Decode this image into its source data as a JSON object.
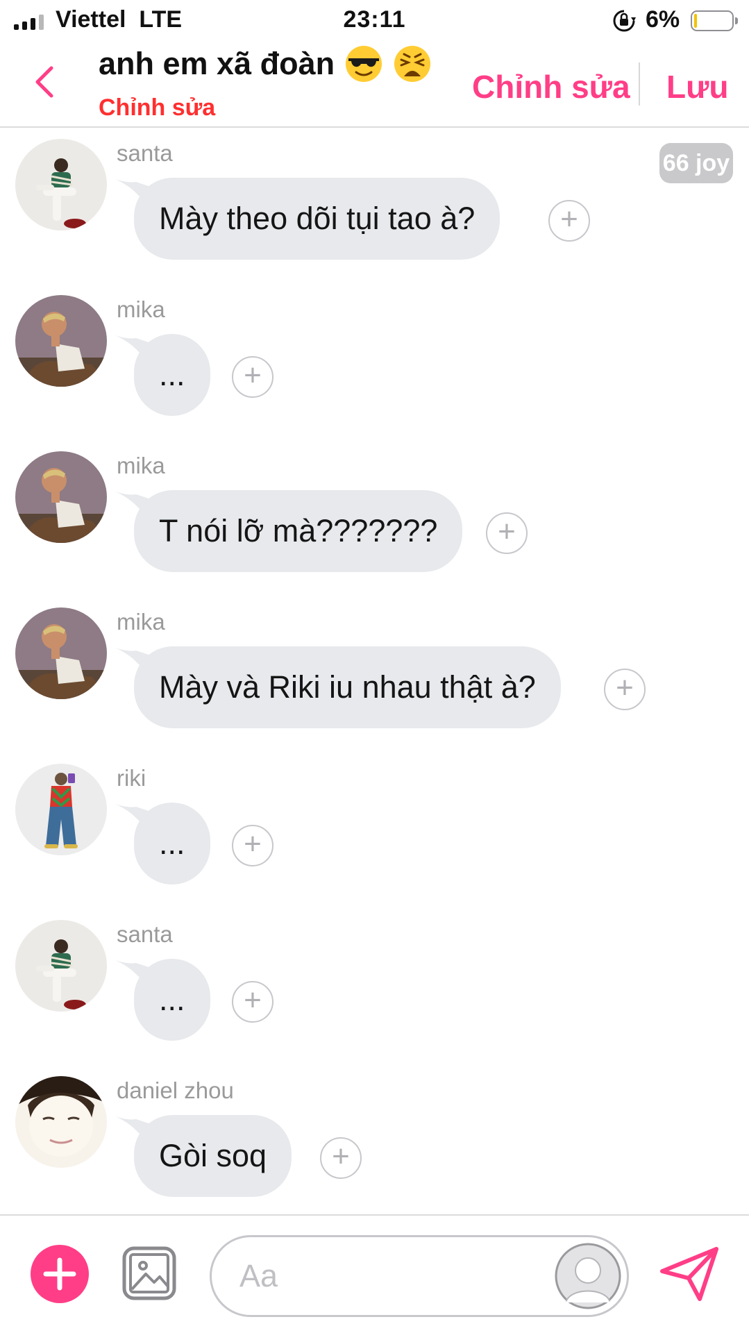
{
  "status_bar": {
    "carrier": "Viettel",
    "network": "LTE",
    "time": "23:11",
    "battery_percent": "6%",
    "battery_level": 0.06,
    "icons": [
      "signal-bars-icon",
      "orientation-lock-icon",
      "battery-icon"
    ]
  },
  "header": {
    "title": "anh em xã đoàn",
    "title_emojis": [
      "smiling-face-with-sunglasses",
      "weary-face"
    ],
    "subtitle": "Chỉnh sửa",
    "edit_label": "Chỉnh sửa",
    "save_label": "Lưu",
    "back_icon": "chevron-left-icon"
  },
  "messages": [
    {
      "sender": "santa",
      "text": "Mày theo dõi tụi tao à?",
      "badge": "66 joy"
    },
    {
      "sender": "mika",
      "text": "..."
    },
    {
      "sender": "mika",
      "text": "T nói lỡ mà???????"
    },
    {
      "sender": "mika",
      "text": "Mày và Riki iu nhau thật à?"
    },
    {
      "sender": "riki",
      "text": "..."
    },
    {
      "sender": "santa",
      "text": "..."
    },
    {
      "sender": "daniel zhou",
      "text": "Gòi soq"
    }
  ],
  "composer": {
    "placeholder": "Aa",
    "icons": [
      "plus-icon",
      "image-icon",
      "avatar-icon",
      "send-icon"
    ]
  },
  "colors": {
    "accent": "#ff3e87",
    "subtitle_red": "#ff2f2f",
    "bubble_bg": "#e7e9ec",
    "sender_gray": "#9a9a9a"
  }
}
